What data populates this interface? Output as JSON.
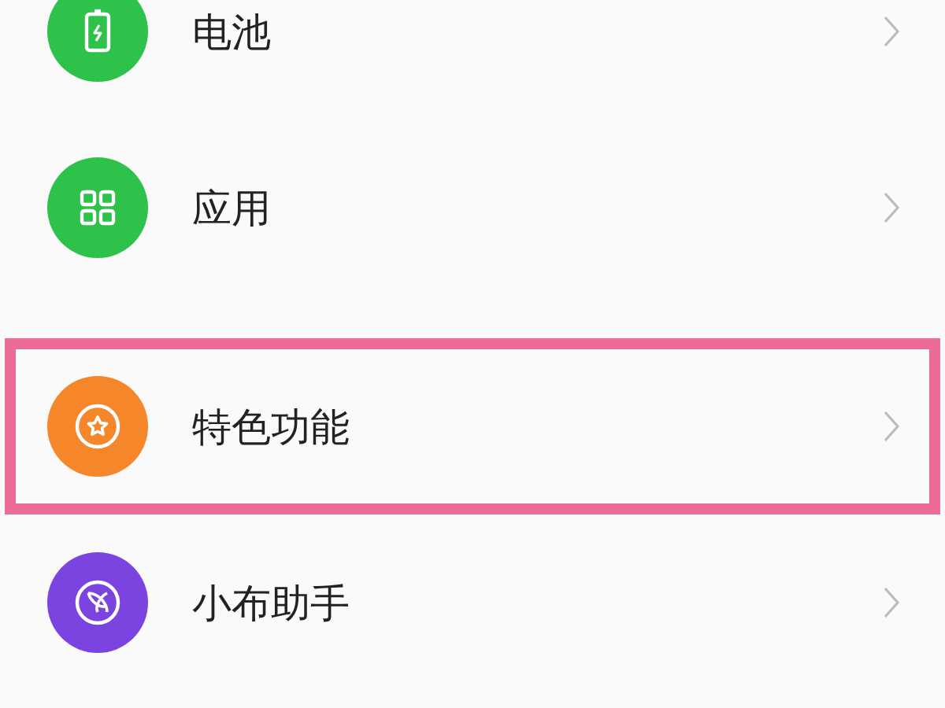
{
  "settings": [
    {
      "label": "电池",
      "kind": "battery",
      "color": "#2ec24a",
      "highlighted": false,
      "section_start": false
    },
    {
      "label": "应用",
      "kind": "apps",
      "color": "#2ec24a",
      "highlighted": false,
      "section_start": false
    },
    {
      "label": "特色功能",
      "kind": "star",
      "color": "#f5862a",
      "highlighted": true,
      "section_start": true
    },
    {
      "label": "小布助手",
      "kind": "assistant",
      "color": "#7b44e0",
      "highlighted": false,
      "section_start": false
    }
  ]
}
